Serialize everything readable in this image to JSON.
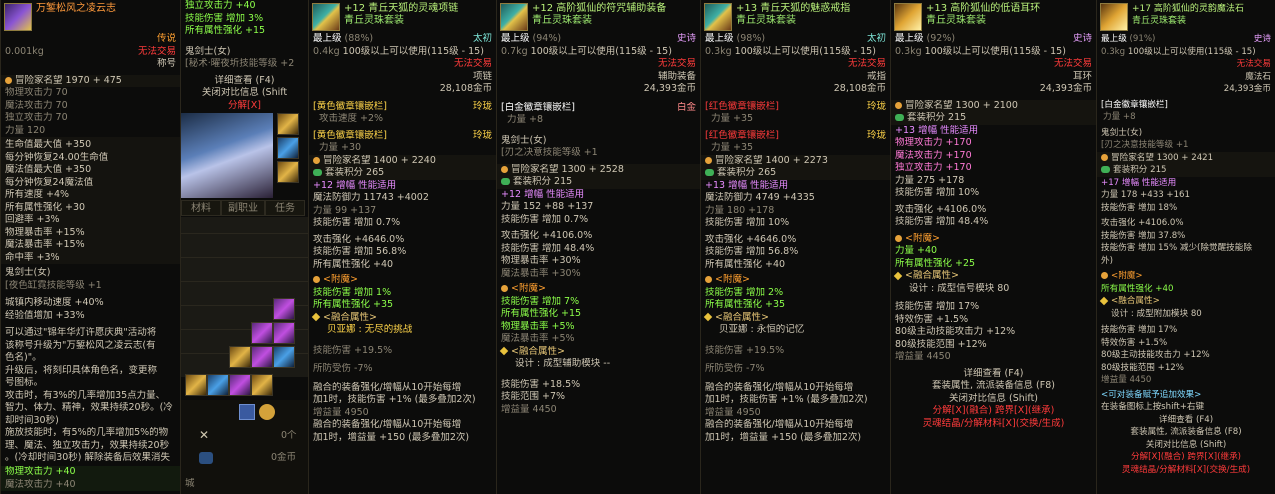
{
  "p1": {
    "title": "万錾松风之凌云志",
    "weight": "0.001kg",
    "rarity": "传说",
    "no_trade": "无法交易",
    "type": "称号",
    "fame": "冒险家名望 1970 + 475",
    "stats": [
      "物理攻击力 70",
      "魔法攻击力 70",
      "独立攻击力 70",
      "力量 120"
    ],
    "bonus": [
      "生命值最大值 +350",
      "每分钟恢复24.00生命值",
      "魔法值最大值 +350",
      "每分钟恢复24魔法值",
      "所有速度 +4%",
      "所有属性强化 +30",
      "回避率 +3%",
      "物理暴击率 +15%",
      "魔法暴击率 +15%",
      "命中率 +3%"
    ],
    "class": "鬼剑士(女)",
    "skill": "[夜色缸霓技能等级 +1",
    "city1": "城镇内移动速度 +40%",
    "city2": "经验值增加 +33%",
    "desc": [
      "可以通过\"锦年华灯许愿庆典\"活动将",
      "该称号升级为\"万錾松风之凌云志(有",
      "色名)\"。",
      "升级后，将刻印具体角色名，变更称",
      "号图标。",
      "攻击时，有3%的几率增加35点力量、",
      "智力、体力、精神，效果持续20秒。(冷",
      "却时间30秒)",
      "施放技能时，有5%的几率增加5%的物",
      "理、魔法、独立攻击力，效果持续20秒",
      "。(冷却时间30秒) 解除装备后效果消失"
    ],
    "foot1": "物理攻击力 +40",
    "foot2": "魔法攻击力 +40"
  },
  "p2": {
    "l1": "独立攻击力 +40",
    "l2": "技能伤害 增加 3%",
    "l3": "所有属性强化 +15",
    "class": "鬼剑士(女)",
    "skill": "[秘术·曜夜圻技能等级 +2",
    "detail": "详细查看 (F4)",
    "contrast": "关闭对比信息 (Shift",
    "decompose": "分解[X]",
    "tabs": [
      "材料",
      "副职业",
      "任务"
    ],
    "gold": "0金币",
    "gold2": "0个",
    "city": "城"
  },
  "p3": {
    "title": "+12 青丘天狐的灵魂项链",
    "set": "青丘灵珠套装",
    "grade": "最上级",
    "grade_pct": "(88%)",
    "rarity": "太初",
    "weight": "0.4kg",
    "level": "100级以上可以使用(115级 - 15)",
    "no_trade": "无法交易",
    "slot": "项链",
    "price": "28,108金币",
    "emblem1": "[黄色徽章镶嵌栏]",
    "emblem1_v": "攻击速度 +2%",
    "emblem1_t": "玲珑",
    "emblem2": "[黄色徽章镶嵌栏]",
    "emblem2_v": "力量 +30",
    "emblem2_t": "玲珑",
    "fame": "冒险家名望 1400 + 2240",
    "setpts": "套装积分 265",
    "amp": "+12 增幅 性能适用",
    "mdef": "魔法防御力 11743 +4002",
    "indep": "力量 99 +137",
    "skill_dmg": "技能伤害 增加 0.7%",
    "atk": "攻击强化 +4646.0%",
    "skill2": "技能伤害 增加 56.8%",
    "allstat": "所有属性强化 +40",
    "enchant": "<附魔>",
    "ench1": "技能伤害 增加 1%",
    "ench2": "所有属性强化 +35",
    "fuse": "<融合属性>",
    "fuse_name": "贝亚娜 : 无尽的挑战",
    "fuse1": "技能伤害 +19.5%",
    "fuse2": "所防受伤 -7%",
    "desc": [
      "融合的装备强化/增幅从10开始每增",
      "加1时，技能伤害 +1% (最多叠加2次)",
      "增益量 4950",
      "融合的装备强化/增幅从10开始每增",
      "加1时，增益量 +150 (最多叠加2次)"
    ]
  },
  "p4": {
    "title": "+12 高阶狐仙的符咒辅助装备",
    "set": "青丘灵珠套装",
    "grade": "最上级",
    "grade_pct": "(94%)",
    "rarity": "史诗",
    "weight": "0.7kg",
    "level": "100级以上可以使用(115级 - 15)",
    "no_trade": "无法交易",
    "slot": "辅助装备",
    "price": "24,393金币",
    "emblem": "[白金徽章镶嵌栏]",
    "emblem_v": "力量 +8",
    "emblem_t": "白金",
    "class": "鬼剑士(女)",
    "skill": "[刃之决意技能等级 +1",
    "fame": "冒险家名望 1300 + 2528",
    "setpts": "套装积分 215",
    "amp": "+12 增幅 性能适用",
    "str": "力量 152 +88 +137",
    "skill_dmg": "技能伤害 增加 0.7%",
    "atk": "攻击强化 +4106.0%",
    "skill2": "技能伤害 增加 48.4%",
    "crit": "物理暴击率 +30%",
    "mcrit": "魔法暴击率 +30%",
    "enchant": "<附魔>",
    "ench1": "技能伤害 增加 7%",
    "ench2": "所有属性强化 +15",
    "ench3": "物理暴击率 +5%",
    "ench4": "魔法暴击率 +5%",
    "fuse": "<融合属性>",
    "fuse_name": "设计 : 成型辅助模块 --",
    "fuse1": "技能伤害 +18.5%",
    "fuse2": "技能范围 +7%",
    "fuse3": "增益量 4450"
  },
  "p5": {
    "title": "+13 青丘天狐的魅惑戒指",
    "set": "青丘灵珠套装",
    "grade": "最上级",
    "grade_pct": "(98%)",
    "rarity": "太初",
    "weight": "0.3kg",
    "level": "100级以上可以使用(115级 - 15)",
    "no_trade": "无法交易",
    "slot": "戒指",
    "price": "28,108金币",
    "emblem1": "[红色徽章镶嵌栏]",
    "emblem1_v": "力量 +35",
    "emblem1_t": "玲珑",
    "emblem2": "[红色徽章镶嵌栏]",
    "emblem2_v": "力量 +35",
    "emblem2_t": "玲珑",
    "fame": "冒险家名望 1400 + 2273",
    "setpts": "套装积分 265",
    "amp": "+13 增幅 性能适用",
    "mdef": "魔法防御力 4749 +4335",
    "str": "力量 180 +178",
    "skill_dmg": "技能伤害 增加 10%",
    "atk": "攻击强化 +4646.0%",
    "skill2": "技能伤害 增加 56.8%",
    "allstat": "所有属性强化 +40",
    "enchant": "<附魔>",
    "ench1": "技能伤害 增加 2%",
    "ench2": "所有属性强化 +35",
    "fuse": "<融合属性>",
    "fuse_name": "贝亚娜 : 永恒的记忆",
    "fuse1": "技能伤害 +19.5%",
    "fuse2": "所防受伤 -7%",
    "desc": [
      "融合的装备强化/增幅从10开始每增",
      "加1时，技能伤害 +1% (最多叠加2次)",
      "增益量 4950",
      "融合的装备强化/增幅从10开始每增",
      "加1时，增益量 +150 (最多叠加2次)"
    ]
  },
  "p6": {
    "title": "+13 高阶狐仙的低语耳环",
    "set": "青丘灵珠套装",
    "grade": "最上级",
    "grade_pct": "(92%)",
    "rarity": "史诗",
    "weight": "0.3kg",
    "level": "100级以上可以使用(115级 - 15)",
    "no_trade": "无法交易",
    "slot": "耳环",
    "price": "24,393金币",
    "fame": "冒险家名望 1300 + 2100",
    "setpts": "套装积分 215",
    "amp": "+13 增幅 性能适用",
    "phys": "物理攻击力 +170",
    "mag": "魔法攻击力 +170",
    "indep": "独立攻击力 +170",
    "str": "力量 275 +178",
    "skill_dmg": "技能伤害 增加 10%",
    "atk": "攻击强化 +4106.0%",
    "skill2": "技能伤害 增加 48.4%",
    "enchant": "<附魔>",
    "ench1": "力量 +40",
    "ench2": "所有属性强化 +25",
    "fuse": "<融合属性>",
    "fuse_name": "设计 : 成型信号模块 80",
    "fuse1": "技能伤害 增加 17%",
    "fuse2": "特效伤害 +1.5%",
    "fuse3": "80级主动技能攻击力 +12%",
    "fuse4": "80级技能范围 +12%",
    "fuse5": "增益量 4450",
    "detail": "详细查看 (F4)",
    "set_info": "套装属性, 流派装备信息 (F8)",
    "contrast": "关闭对比信息 (Shift)",
    "decompose": "分解[X](融合) 跨界[X](继承)",
    "crystal": "灵魂结晶/分解材料[X](交换/生成)"
  },
  "p7": {
    "title": "+17 高阶狐仙的灵韵魔法石",
    "set": "青丘灵珠套装",
    "grade": "最上级",
    "grade_pct": "(91%)",
    "rarity": "史诗",
    "weight": "0.3kg",
    "level": "100级以上可以使用(115级 - 15)",
    "no_trade": "无法交易",
    "slot": "魔法石",
    "price": "24,393金币",
    "emblem": "[白金徽章镶嵌栏]",
    "emblem_v": "力量 +8",
    "class": "鬼剑士(女)",
    "skill": "[刃之决意技能等级 +1",
    "fame": "冒险家名望 1300 + 2421",
    "setpts": "套装积分 215",
    "amp": "+17 增幅 性能适用",
    "str": "力量 178 +433 +161",
    "skill_dmg": "技能伤害 增加 18%",
    "atk": "攻击强化 +4106.0%",
    "skill2": "技能伤害 增加 37.8%",
    "skill3": "技能伤害 增加 15% 减少(除觉醒技能除",
    "skill3b": "外)",
    "enchant": "<附魔>",
    "ench1": "所有属性强化 +40",
    "fuse": "<融合属性>",
    "fuse_name": "设计 : 成型附加模块 80",
    "fuse1": "技能伤害 增加 17%",
    "fuse2": "特效伤害 +1.5%",
    "fuse3": "80级主动技能攻击力 +12%",
    "fuse4": "80级技能范围 +12%",
    "fuse5": "增益量 4450",
    "extra": "<可对装备赋予追加效果>",
    "extra2": "在装备图标上按shift+右键",
    "detail": "详细查看 (F4)",
    "set_info": "套装属性, 流派装备信息 (F8)",
    "contrast": "关闭对比信息 (Shift)",
    "decompose": "分解[X](融合) 跨界[X](继承)",
    "crystal": "灵魂结晶/分解材料[X](交换/生成)"
  }
}
